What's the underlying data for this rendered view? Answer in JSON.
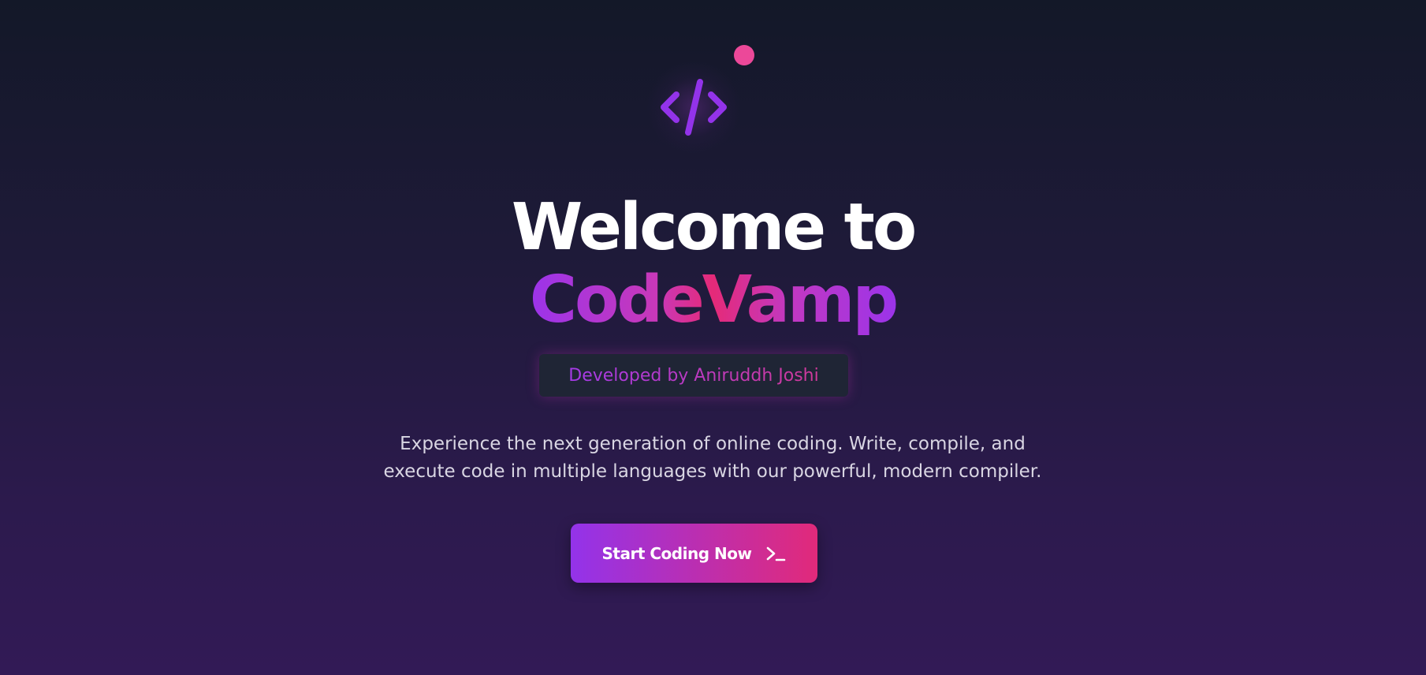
{
  "hero": {
    "logo_icon": "code-brackets-icon",
    "title_line1": "Welcome to",
    "title_line2": "CodeVamp",
    "badge_text": "Developed by Aniruddh Joshi",
    "tagline_line1": "Experience the next generation of online coding. Write, compile, and",
    "tagline_line2": "execute code in multiple languages with our powerful, modern compiler.",
    "cta_label": "Start Coding Now",
    "cta_icon": "terminal-icon"
  },
  "colors": {
    "accent_purple": "#9333ea",
    "accent_pink": "#e12a7a",
    "dot_pink": "#ec4899",
    "badge_bg": "#1f2535",
    "background_top": "#131828",
    "background_bottom": "#321a56"
  }
}
